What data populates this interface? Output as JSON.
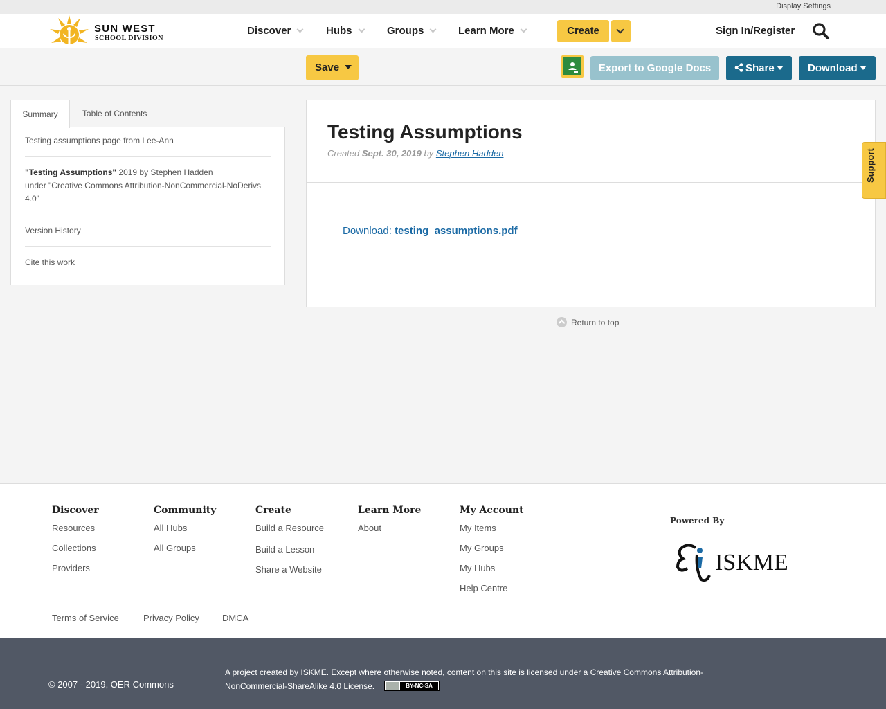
{
  "utility": {
    "display_settings": "Display Settings"
  },
  "brand": {
    "line1": "SUN WEST",
    "line2": "SCHOOL DIVISION"
  },
  "nav": {
    "items": [
      {
        "label": "Discover"
      },
      {
        "label": "Hubs"
      },
      {
        "label": "Groups"
      },
      {
        "label": "Learn More"
      }
    ],
    "create_label": "Create",
    "signin_label": "Sign In/Register",
    "search_icon": "search-icon"
  },
  "toolbar": {
    "save_label": "Save",
    "export_label": "Export to Google Docs",
    "share_label": "Share",
    "download_label": "Download"
  },
  "sidebar": {
    "tabs": [
      "Summary",
      "Table of Contents"
    ],
    "summary_text": "Testing assumptions page from Lee-Ann",
    "attribution_title": "\"Testing Assumptions\"",
    "attribution_rest": " 2019 by Stephen Hadden",
    "attribution_license": "under \"Creative Commons Attribution-NonCommercial-NoDerivs 4.0\"",
    "version_history": "Version History",
    "cite": "Cite this work"
  },
  "resource": {
    "title": "Testing Assumptions",
    "created_prefix": "Created",
    "created_date": "Sept. 30, 2019",
    "by": "by",
    "author": "Stephen Hadden",
    "download_prefix": "Download:",
    "download_file": "testing_assumptions.pdf"
  },
  "return_top": "Return to top",
  "support": "Support",
  "footer": {
    "columns": [
      {
        "heading": "Discover",
        "links": [
          "Resources",
          "Collections",
          "Providers"
        ]
      },
      {
        "heading": "Community",
        "links": [
          "All Hubs",
          "All Groups"
        ]
      },
      {
        "heading": "Create",
        "links": [
          "Build a Resource",
          "Build a Lesson",
          "Share a Website"
        ]
      },
      {
        "heading": "Learn More",
        "links": [
          "About"
        ]
      },
      {
        "heading": "My Account",
        "links": [
          "My Items",
          "My Groups",
          "My Hubs",
          "Help Centre"
        ]
      }
    ],
    "powered_by": "Powered By",
    "iskme_logo_text": "ISKME",
    "legal": [
      "Terms of Service",
      "Privacy Policy",
      "DMCA"
    ]
  },
  "bottom": {
    "copyright": "© 2007 - 2019, OER Commons",
    "project": "A project created by ISKME. Except where otherwise noted, content on this site is licensed under a Creative Commons Attribution-NonCommercial-ShareAlike 4.0 License.",
    "cc_badge": "BY-NC-SA"
  },
  "colors": {
    "accent_yellow": "#f7c843",
    "primary_blue": "#1b6a8c",
    "export_disabled": "#98c2cd",
    "link_blue": "#1b6aa5",
    "footer_dark": "#515865"
  }
}
